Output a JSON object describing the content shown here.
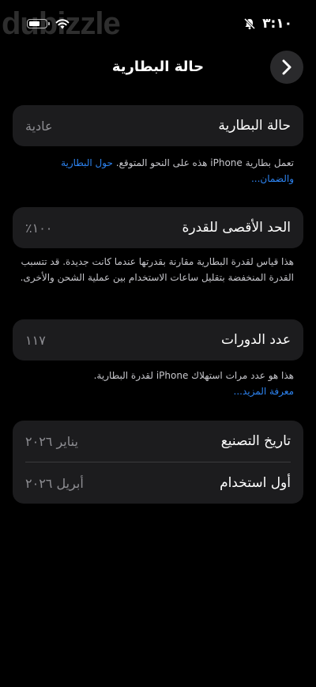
{
  "status": {
    "time": "٣:١٠"
  },
  "watermark": "dubizzle",
  "nav": {
    "title": "حالة البطارية"
  },
  "health": {
    "label": "حالة البطارية",
    "value": "عادية"
  },
  "health_note": {
    "text": "تعمل بطارية iPhone هذه على النحو المتوقع. ",
    "link": "حول البطارية والضمان..."
  },
  "max_capacity": {
    "label": "الحد الأقصى للقدرة",
    "value": "١٠٠٪"
  },
  "capacity_note": {
    "text": "هذا قياس لقدرة البطارية مقارنة بقدرتها عندما كانت جديدة. قد تتسبب القدرة المنخفضة بتقليل ساعات الاستخدام بين عملية الشحن والأخرى."
  },
  "cycle_count": {
    "label": "عدد الدورات",
    "value": "١١٧"
  },
  "cycle_note": {
    "text": "هذا هو عدد مرات استهلاك iPhone لقدرة البطارية.",
    "link": "معرفة المزيد..."
  },
  "dates": {
    "manufacture": {
      "label": "تاريخ التصنيع",
      "value": "يناير ٢٠٢٦"
    },
    "first_use": {
      "label": "أول استخدام",
      "value": "أبريل ٢٠٢٦"
    }
  }
}
